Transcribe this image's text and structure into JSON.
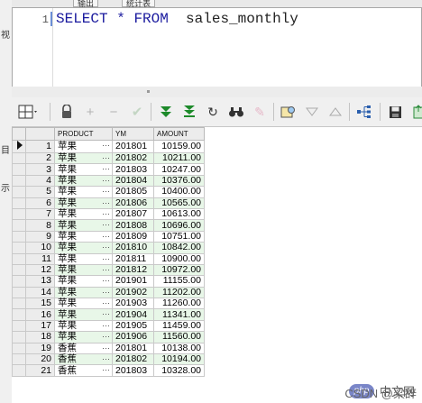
{
  "sidebar_glyphs": [
    "视",
    "目",
    "示"
  ],
  "tabs": [
    "输出",
    "统计表"
  ],
  "editor": {
    "line_number": "1",
    "sql_keyword_select": "SELECT",
    "sql_star": "*",
    "sql_keyword_from": "FROM",
    "sql_table": "sales_monthly"
  },
  "toolbar": {
    "icons": [
      "grid-menu-icon",
      "lock-icon",
      "add-row-icon",
      "delete-row-icon",
      "post-icon",
      "next-page-icon",
      "last-page-icon",
      "refresh-icon",
      "find-icon",
      "clear-icon",
      "filter-icon",
      "sort-down-icon",
      "sort-up-icon",
      "tree-icon",
      "save-icon",
      "export-icon"
    ]
  },
  "grid": {
    "columns": [
      "PRODUCT",
      "YM",
      "AMOUNT"
    ],
    "rows": [
      {
        "n": "1",
        "product": "苹果",
        "ym": "201801",
        "amount": "10159.00"
      },
      {
        "n": "2",
        "product": "苹果",
        "ym": "201802",
        "amount": "10211.00"
      },
      {
        "n": "3",
        "product": "苹果",
        "ym": "201803",
        "amount": "10247.00"
      },
      {
        "n": "4",
        "product": "苹果",
        "ym": "201804",
        "amount": "10376.00"
      },
      {
        "n": "5",
        "product": "苹果",
        "ym": "201805",
        "amount": "10400.00"
      },
      {
        "n": "6",
        "product": "苹果",
        "ym": "201806",
        "amount": "10565.00"
      },
      {
        "n": "7",
        "product": "苹果",
        "ym": "201807",
        "amount": "10613.00"
      },
      {
        "n": "8",
        "product": "苹果",
        "ym": "201808",
        "amount": "10696.00"
      },
      {
        "n": "9",
        "product": "苹果",
        "ym": "201809",
        "amount": "10751.00"
      },
      {
        "n": "10",
        "product": "苹果",
        "ym": "201810",
        "amount": "10842.00"
      },
      {
        "n": "11",
        "product": "苹果",
        "ym": "201811",
        "amount": "10900.00"
      },
      {
        "n": "12",
        "product": "苹果",
        "ym": "201812",
        "amount": "10972.00"
      },
      {
        "n": "13",
        "product": "苹果",
        "ym": "201901",
        "amount": "11155.00"
      },
      {
        "n": "14",
        "product": "苹果",
        "ym": "201902",
        "amount": "11202.00"
      },
      {
        "n": "15",
        "product": "苹果",
        "ym": "201903",
        "amount": "11260.00"
      },
      {
        "n": "16",
        "product": "苹果",
        "ym": "201904",
        "amount": "11341.00"
      },
      {
        "n": "17",
        "product": "苹果",
        "ym": "201905",
        "amount": "11459.00"
      },
      {
        "n": "18",
        "product": "苹果",
        "ym": "201906",
        "amount": "11560.00"
      },
      {
        "n": "19",
        "product": "香蕉",
        "ym": "201801",
        "amount": "10138.00"
      },
      {
        "n": "20",
        "product": "香蕉",
        "ym": "201802",
        "amount": "10194.00"
      },
      {
        "n": "21",
        "product": "香蕉",
        "ym": "201803",
        "amount": "10328.00"
      }
    ],
    "ellipsis": "···"
  },
  "watermark": {
    "logo_text": "php",
    "badge_text": "中文网",
    "credit": "CSDN @梁辞"
  }
}
